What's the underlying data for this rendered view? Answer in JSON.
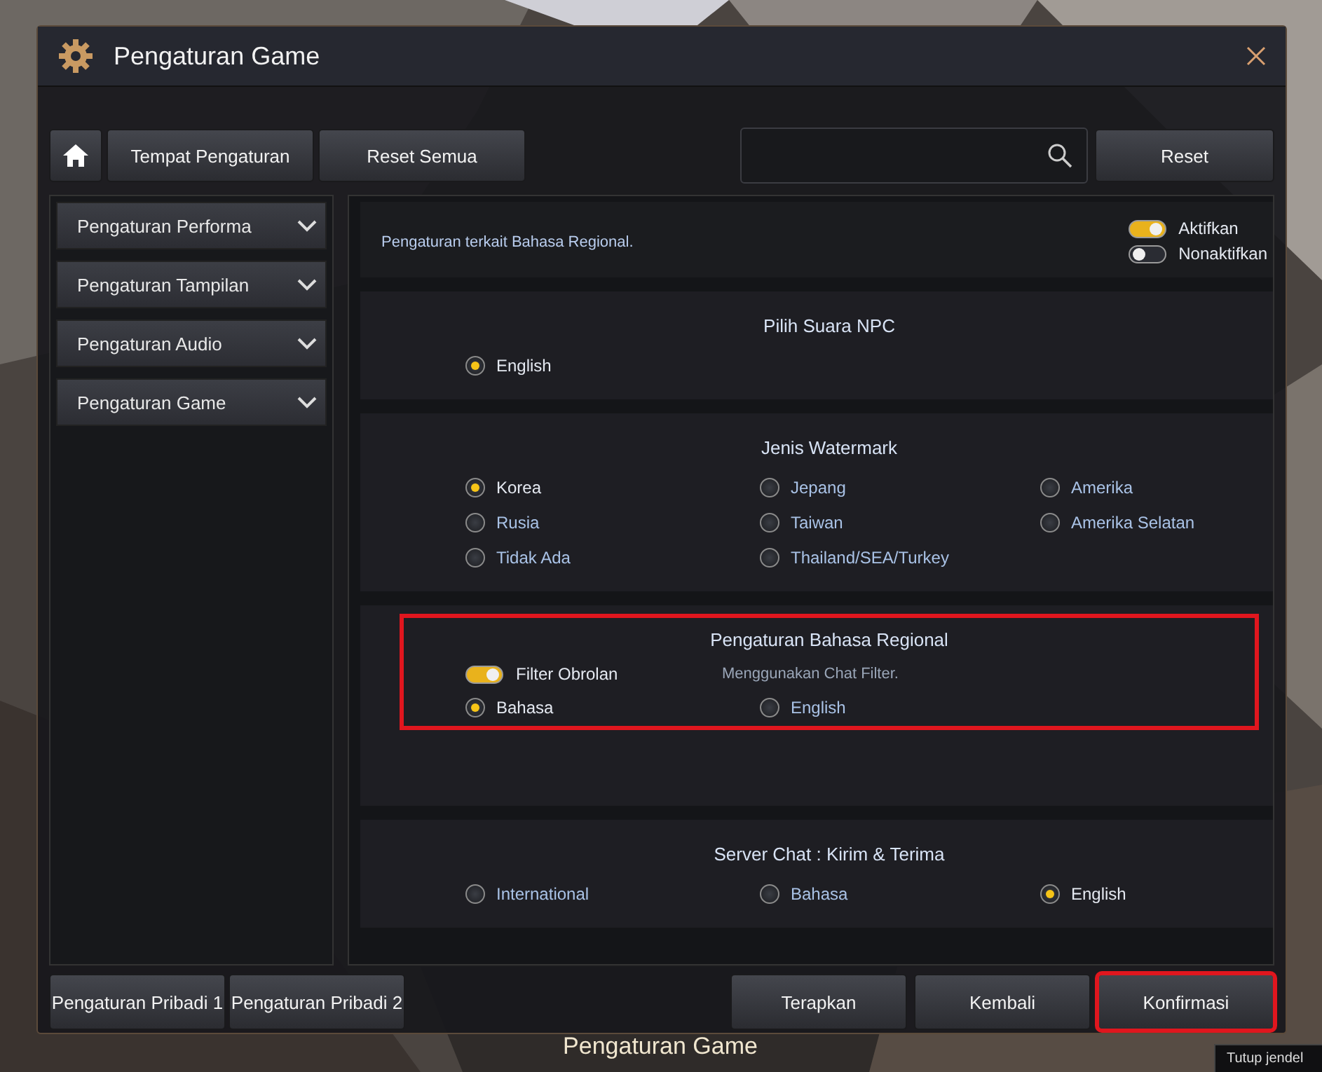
{
  "window": {
    "title": "Pengaturan Game"
  },
  "toolbar": {
    "buttons": [
      "Tempat Pengaturan",
      "Reset Semua"
    ],
    "reset": "Reset"
  },
  "sidebar": {
    "items": [
      {
        "label": "Pengaturan Performa",
        "expanded": false
      },
      {
        "label": "Pengaturan Tampilan",
        "expanded": false
      },
      {
        "label": "Pengaturan Audio",
        "expanded": false
      },
      {
        "label": "Pengaturan Game",
        "expanded": false
      }
    ]
  },
  "panel": {
    "description": "Pengaturan terkait Bahasa Regional.",
    "legend": [
      {
        "label": "Aktifkan",
        "on": true
      },
      {
        "label": "Nonaktifkan",
        "on": false
      }
    ],
    "sections": [
      {
        "title": "Pilih Suara NPC",
        "highlighted": false,
        "options": [
          {
            "label": "English",
            "selected": true
          }
        ]
      },
      {
        "title": "Jenis Watermark",
        "highlighted": false,
        "options": [
          {
            "label": "Korea",
            "selected": true
          },
          {
            "label": "Jepang",
            "selected": false
          },
          {
            "label": "Amerika",
            "selected": false
          },
          {
            "label": "Rusia",
            "selected": false
          },
          {
            "label": "Taiwan",
            "selected": false
          },
          {
            "label": "Amerika Selatan",
            "selected": false
          },
          {
            "label": "Tidak Ada",
            "selected": false
          },
          {
            "label": "Thailand/SEA/Turkey",
            "selected": false
          }
        ]
      },
      {
        "title": "Pengaturan Bahasa Regional",
        "highlighted": true,
        "toggle": {
          "label": "Filter Obrolan",
          "on": true,
          "description": "Menggunakan Chat Filter."
        },
        "options": [
          {
            "label": "Bahasa",
            "selected": true
          },
          {
            "label": "English",
            "selected": false
          }
        ]
      },
      {
        "title": "Server Chat : Kirim & Terima",
        "highlighted": false,
        "options": [
          {
            "label": "International",
            "selected": false
          },
          {
            "label": "Bahasa",
            "selected": false
          },
          {
            "label": "English",
            "selected": true
          }
        ]
      }
    ]
  },
  "footer": {
    "presets": [
      "Pengaturan Pribadi 1",
      "Pengaturan Pribadi 2"
    ],
    "actions": [
      {
        "label": "Terapkan",
        "highlighted": false
      },
      {
        "label": "Kembali",
        "highlighted": false
      },
      {
        "label": "Konfirmasi",
        "highlighted": true
      }
    ]
  },
  "background": {
    "caption": "Pengaturan Game",
    "tooltip": "Tutup jendel"
  }
}
